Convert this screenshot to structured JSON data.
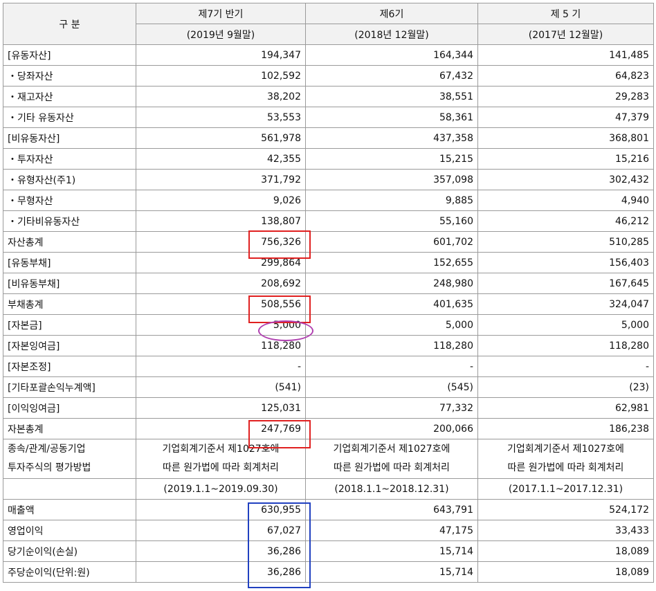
{
  "header": {
    "category_label": "구 분",
    "periods": [
      {
        "name": "제7기 반기",
        "date": "(2019년 9월말)"
      },
      {
        "name": "제6기",
        "date": "(2018년 12월말)"
      },
      {
        "name": "제 5 기",
        "date": "(2017년 12월말)"
      }
    ]
  },
  "rows": [
    {
      "label": "[유동자산]",
      "values": [
        "194,347",
        "164,344",
        "141,485"
      ]
    },
    {
      "label": "・당좌자산",
      "values": [
        "102,592",
        "67,432",
        "64,823"
      ]
    },
    {
      "label": "・재고자산",
      "values": [
        "38,202",
        "38,551",
        "29,283"
      ]
    },
    {
      "label": "・기타 유동자산",
      "values": [
        "53,553",
        "58,361",
        "47,379"
      ]
    },
    {
      "label": "[비유동자산]",
      "values": [
        "561,978",
        "437,358",
        "368,801"
      ]
    },
    {
      "label": "・투자자산",
      "values": [
        "42,355",
        "15,215",
        "15,216"
      ]
    },
    {
      "label": "・유형자산(주1)",
      "values": [
        "371,792",
        "357,098",
        "302,432"
      ]
    },
    {
      "label": "・무형자산",
      "values": [
        "9,026",
        "9,885",
        "4,940"
      ]
    },
    {
      "label": "・기타비유동자산",
      "values": [
        "138,807",
        "55,160",
        "46,212"
      ]
    },
    {
      "label": "자산총계",
      "values": [
        "756,326",
        "601,702",
        "510,285"
      ]
    },
    {
      "label": "[유동부채]",
      "values": [
        "299,864",
        "152,655",
        "156,403"
      ]
    },
    {
      "label": "[비유동부채]",
      "values": [
        "208,692",
        "248,980",
        "167,645"
      ]
    },
    {
      "label": "부채총계",
      "values": [
        "508,556",
        "401,635",
        "324,047"
      ]
    },
    {
      "label": "[자본금]",
      "values": [
        "5,000",
        "5,000",
        "5,000"
      ]
    },
    {
      "label": "[자본잉여금]",
      "values": [
        "118,280",
        "118,280",
        "118,280"
      ]
    },
    {
      "label": "[자본조정]",
      "values": [
        "-",
        "-",
        "-"
      ]
    },
    {
      "label": "[기타포괄손익누계액]",
      "values": [
        "(541)",
        "(545)",
        "(23)"
      ]
    },
    {
      "label": "[이익잉여금]",
      "values": [
        "125,031",
        "77,332",
        "62,981"
      ]
    },
    {
      "label": "자본총계",
      "values": [
        "247,769",
        "200,066",
        "186,238"
      ]
    }
  ],
  "method": {
    "label_line1": "종속/관계/공동기업",
    "label_line2": "투자주식의 평가방법",
    "text_line1": "기업회계기준서 제1027호에",
    "text_line2": "따른 원가법에 따라 회계처리"
  },
  "income_periods": [
    "(2019.1.1~2019.09.30)",
    "(2018.1.1~2018.12.31)",
    "(2017.1.1~2017.12.31)"
  ],
  "income_rows": [
    {
      "label": "매출액",
      "values": [
        "630,955",
        "643,791",
        "524,172"
      ]
    },
    {
      "label": "영업이익",
      "values": [
        "67,027",
        "47,175",
        "33,433"
      ]
    },
    {
      "label": "당기순이익(손실)",
      "values": [
        "36,286",
        "15,714",
        "18,089"
      ]
    },
    {
      "label": "주당순이익(단위:원)",
      "values": [
        "36,286",
        "15,714",
        "18,089"
      ]
    }
  ],
  "highlight_colors": {
    "red": "#e02020",
    "purple": "#b040b0",
    "blue": "#2040c0"
  }
}
